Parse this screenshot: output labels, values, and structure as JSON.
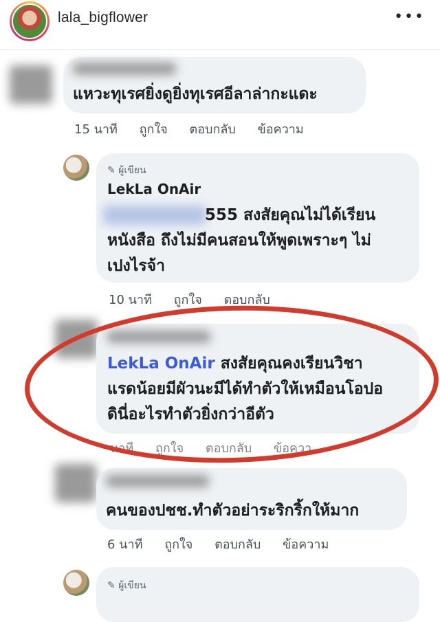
{
  "header": {
    "username": "lala_bigflower",
    "more_label": "•••"
  },
  "comments": [
    {
      "text_lines": [
        "แหวะทุเรศยิ่งดูยิ่งทุเรศอีลาล่ากะแดะ"
      ],
      "actions": [
        "15 นาที",
        "ถูกใจ",
        "ตอบกลับ",
        "ข้อความ"
      ]
    },
    {
      "badge": "✎ ผู้เขียน",
      "author": "LekLa OnAir",
      "text_lines": [
        "555 สงสัยคุณไม่ได้เรียน",
        "หนังสือ ถึงไม่มีคนสอนให้พูดเพราะๆ ไม่",
        "เปงไรจ้า"
      ],
      "actions": [
        "10 นาที",
        "ถูกใจ",
        "ตอบกลับ"
      ]
    },
    {
      "tag": "LekLa OnAir",
      "text_lines": [
        " สงสัยคุณคงเรียนวิชา",
        "แรดน้อยมีผัวนะมีได้ทำตัวให้เหมือนโอปอ",
        "ดินี่อะไรทำตัวยิ่งกว่าอีตัว"
      ],
      "actions": [
        "นาที",
        "ถูกใจ",
        "ตอบกลับ",
        "ข้อควา"
      ]
    },
    {
      "text_lines": [
        "คนของปชช.ทำตัวอย่าระริกริ้กให้มาก"
      ],
      "actions": [
        "6 นาที",
        "ถูกใจ",
        "ตอบกลับ",
        "ข้อความ"
      ]
    },
    {
      "badge": "✎ ผู้เขียน"
    }
  ]
}
